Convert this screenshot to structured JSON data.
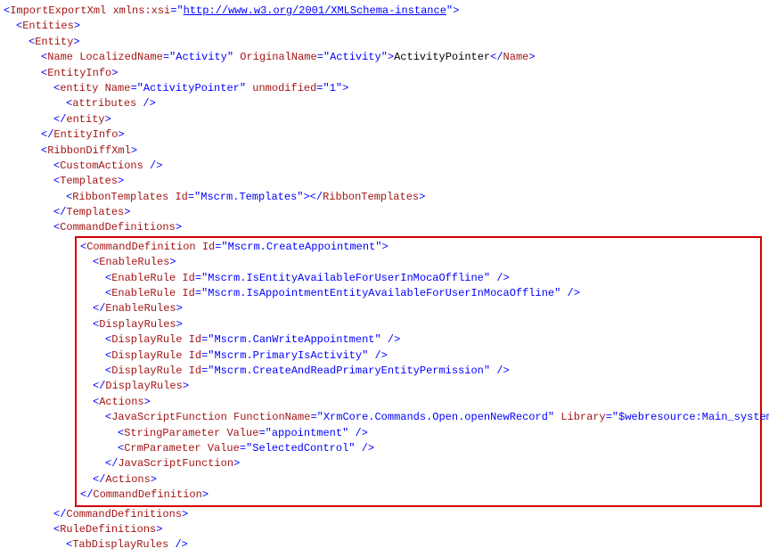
{
  "ns_uri": "http://www.w3.org/2001/XMLSchema-instance",
  "name": {
    "localized": "Activity",
    "original": "Activity",
    "text": "ActivityPointer"
  },
  "entity": {
    "name": "ActivityPointer",
    "unmodified": "1"
  },
  "ribbonTemplates_id": "Mscrm.Templates",
  "cmd": {
    "id": "Mscrm.CreateAppointment",
    "enableRules": [
      "Mscrm.IsEntityAvailableForUserInMocaOffline",
      "Mscrm.IsAppointmentEntityAvailableForUserInMocaOffline"
    ],
    "displayRules": [
      "Mscrm.CanWriteAppointment",
      "Mscrm.PrimaryIsActivity",
      "Mscrm.CreateAndReadPrimaryEntityPermission"
    ],
    "js": {
      "fn": "XrmCore.Commands.Open.openNewRecord",
      "lib": "$webresource:Main_system_library.js",
      "stringParam": "appointment",
      "crmParam": "SelectedControl"
    }
  }
}
